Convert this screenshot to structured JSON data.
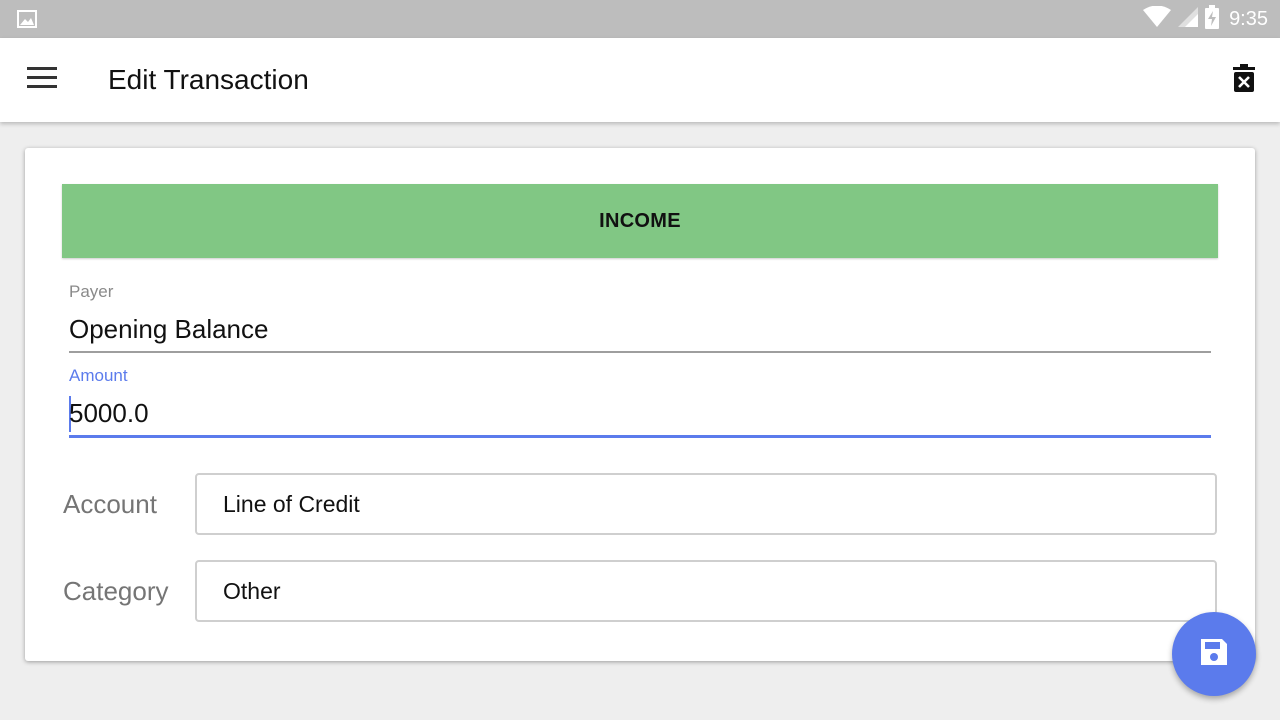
{
  "status_bar": {
    "time": "9:35",
    "icons": [
      "image-icon",
      "wifi-icon",
      "cell-signal-icon",
      "battery-charging-icon"
    ]
  },
  "app_bar": {
    "title": "Edit Transaction",
    "menu_icon": "menu-icon",
    "delete_icon": "delete-icon"
  },
  "form": {
    "type_toggle_label": "INCOME",
    "type_color": "#81c784",
    "payer": {
      "label": "Payer",
      "value": "Opening Balance"
    },
    "amount": {
      "label": "Amount",
      "value": "5000.0"
    },
    "account": {
      "label": "Account",
      "value": "Line of Credit"
    },
    "category": {
      "label": "Category",
      "value": "Other"
    }
  },
  "fab": {
    "icon": "save-icon",
    "color": "#5b7bec"
  },
  "colors": {
    "accent": "#5b7bec",
    "status_bar": "#bdbdbd"
  }
}
